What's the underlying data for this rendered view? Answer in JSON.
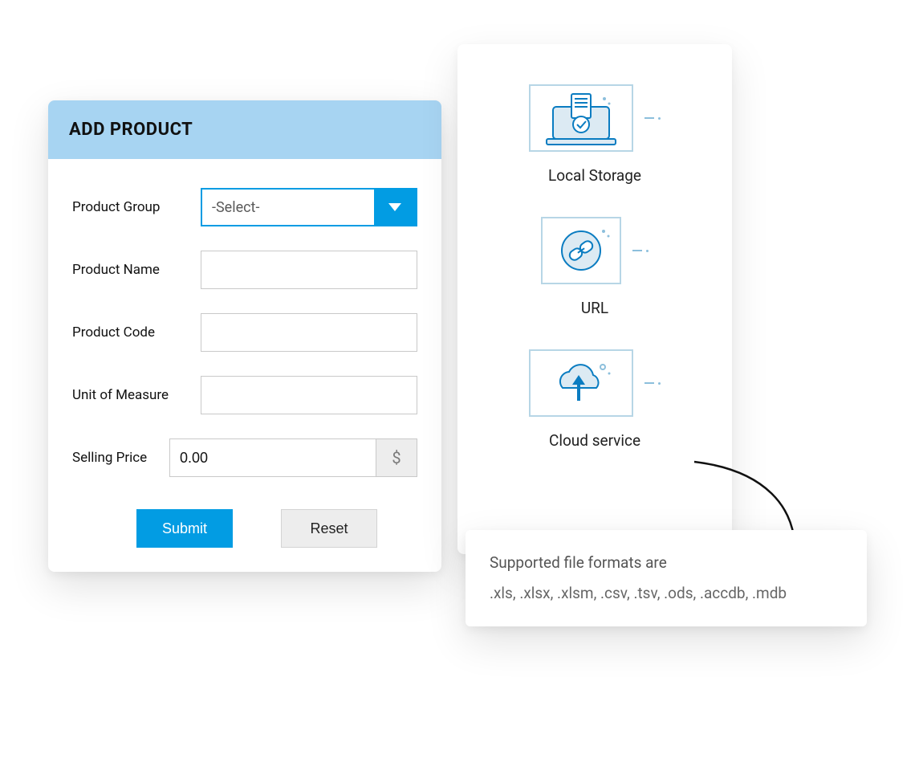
{
  "form": {
    "title": "ADD PRODUCT",
    "labels": {
      "product_group": "Product Group",
      "product_name": "Product Name",
      "product_code": "Product Code",
      "unit_of_measure": "Unit of Measure",
      "selling_price": "Selling Price"
    },
    "product_group_select": "-Select-",
    "product_name_value": "",
    "product_code_value": "",
    "unit_of_measure_value": "",
    "selling_price_value": "0.00",
    "currency_symbol": "$",
    "buttons": {
      "submit": "Submit",
      "reset": "Reset"
    }
  },
  "sources": [
    {
      "label": "Local Storage",
      "icon": "local-storage-icon"
    },
    {
      "label": "URL",
      "icon": "url-icon"
    },
    {
      "label": "Cloud service",
      "icon": "cloud-service-icon"
    }
  ],
  "formats": {
    "title": "Supported file formats are",
    "list": ".xls, .xlsx, .xlsm, .csv, .tsv, .ods, .accdb, .mdb"
  },
  "colors": {
    "header_bg": "#a7d4f2",
    "accent": "#029ce3",
    "icon_stroke": "#0a7cc1",
    "icon_fill": "#dceaf3"
  }
}
